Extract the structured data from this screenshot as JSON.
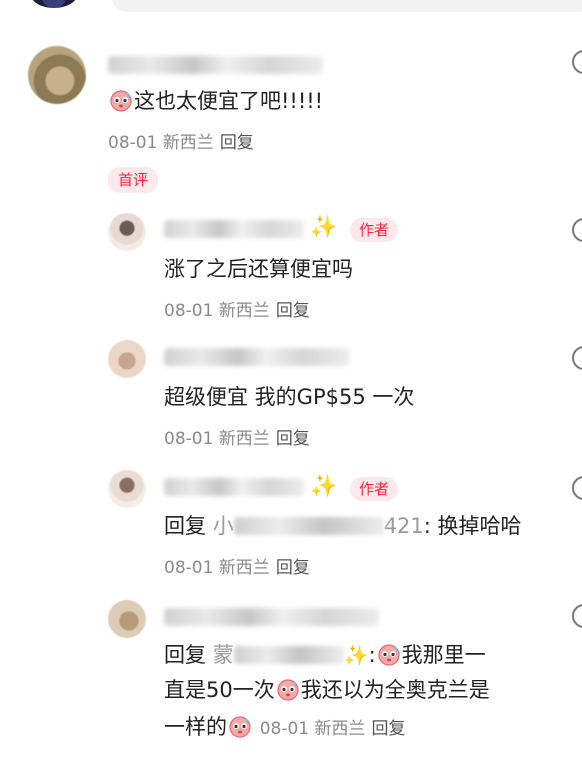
{
  "comments": [
    {
      "text": "这也太便宜了吧!!!!!",
      "date": "08-01",
      "location": "新西兰",
      "reply_label": "回复",
      "badge": "首评"
    },
    {
      "text": "涨了之后还算便宜吗",
      "date": "08-01",
      "location": "新西兰",
      "reply_label": "回复",
      "badge": "作者"
    },
    {
      "text": "超级便宜 我的GP$55 一次",
      "date": "08-01",
      "location": "新西兰",
      "reply_label": "回复"
    },
    {
      "reply_prefix": "回复",
      "target_visible": "小",
      "target_suffix": "421",
      "text": ": 换掉哈哈",
      "date": "08-01",
      "location": "新西兰",
      "reply_label": "回复",
      "badge": "作者"
    },
    {
      "reply_prefix": "回复",
      "target_visible": "蒙",
      "line1": "我那里一",
      "line2_a": "直是50一次",
      "line2_b": "我还以为全奥克兰是",
      "line3": "一样的",
      "date": "08-01",
      "location": "新西兰",
      "reply_label": "回复"
    }
  ]
}
